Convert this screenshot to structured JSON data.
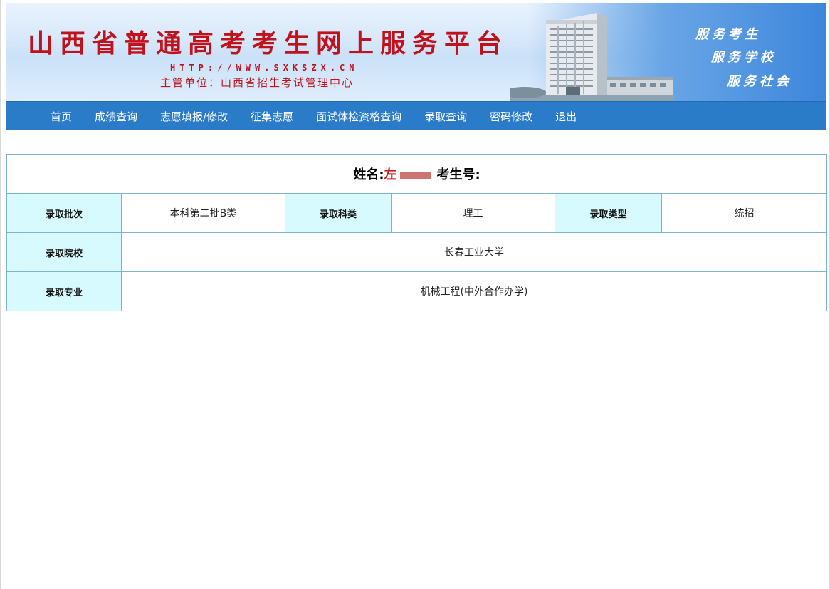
{
  "banner": {
    "title": "山西省普通高考考生网上服务平台",
    "url": "HTTP://WWW.SXKSZX.CN",
    "unit": "主管单位：山西省招生考试管理中心",
    "slogans": [
      "服务考生",
      "服务学校",
      "服务社会"
    ],
    "title_color": "#c1121c"
  },
  "nav": {
    "items": [
      {
        "label": "首页"
      },
      {
        "label": "成绩查询"
      },
      {
        "label": "志愿填报/修改"
      },
      {
        "label": "征集志愿"
      },
      {
        "label": "面试体检资格查询"
      },
      {
        "label": "录取查询"
      },
      {
        "label": "密码修改"
      },
      {
        "label": "退出"
      }
    ],
    "bar_color": "#2a7cc8"
  },
  "result": {
    "name_label": "姓名:",
    "name_value": "左",
    "exam_no_label": "考生号:",
    "exam_no_value": "",
    "batch_label": "录取批次",
    "batch_value": "本科第二批B类",
    "subject_label": "录取科类",
    "subject_value": "理工",
    "type_label": "录取类型",
    "type_value": "统招",
    "school_label": "录取院校",
    "school_value": "长春工业大学",
    "major_label": "录取专业",
    "major_value": "机械工程(中外合作办学)",
    "header_cell_color": "#d6fafd"
  }
}
